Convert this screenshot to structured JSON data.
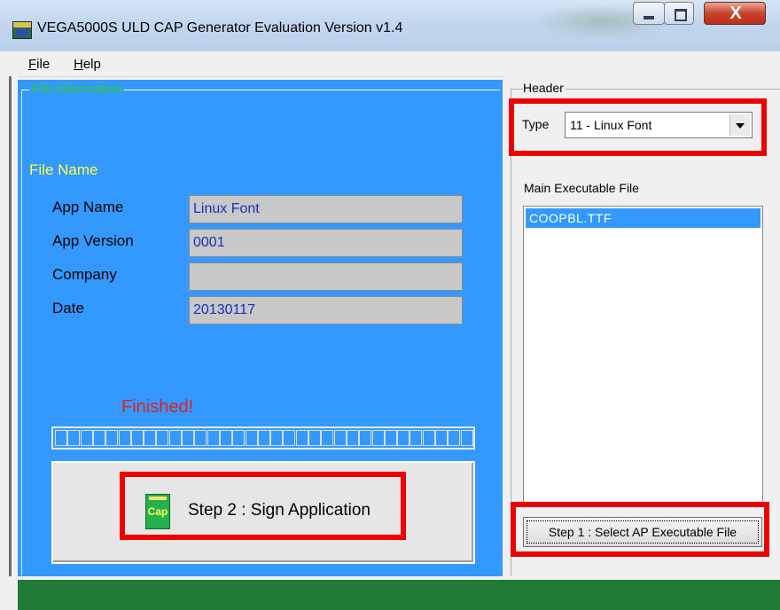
{
  "window": {
    "title": "VEGA5000S ULD CAP Generator Evaluation Version v1.4",
    "icons": {
      "app": "vega-app-icon",
      "minimize": "minimize-icon",
      "maximize": "maximize-icon",
      "close": "close-icon"
    },
    "close_glyph": "X"
  },
  "menu": {
    "file": {
      "accel": "F",
      "rest": "ile"
    },
    "help": {
      "accel": "H",
      "rest": "elp"
    }
  },
  "file_info": {
    "group_title": "File Information",
    "file_name_label": "File Name",
    "fields": [
      {
        "label": "App Name",
        "value": "Linux Font"
      },
      {
        "label": "App Version",
        "value": "0001"
      },
      {
        "label": "Company",
        "value": ""
      },
      {
        "label": "Date",
        "value": "20130117"
      }
    ],
    "status_text": "Finished!",
    "progress_segments": 33,
    "sign_button": {
      "label": "Step 2 : Sign Application",
      "icon_text": "Cap",
      "icon": "cap-file-icon"
    }
  },
  "header_panel": {
    "group_title": "Header",
    "type_label": "Type",
    "type_value": "11 - Linux Font",
    "main_exec_label": "Main Executable File",
    "files": [
      "COOPBL.TTF"
    ],
    "select_button_label": "Step 1 : Select AP Executable File"
  },
  "colors": {
    "panel_blue": "#3399ff",
    "group_title_green": "#33cc33",
    "file_name_yellow": "#ffff44",
    "value_blue": "#1a2fbf",
    "finished_red": "#e02020",
    "highlight_red": "#ee0000",
    "status_green": "#1e7a34"
  }
}
